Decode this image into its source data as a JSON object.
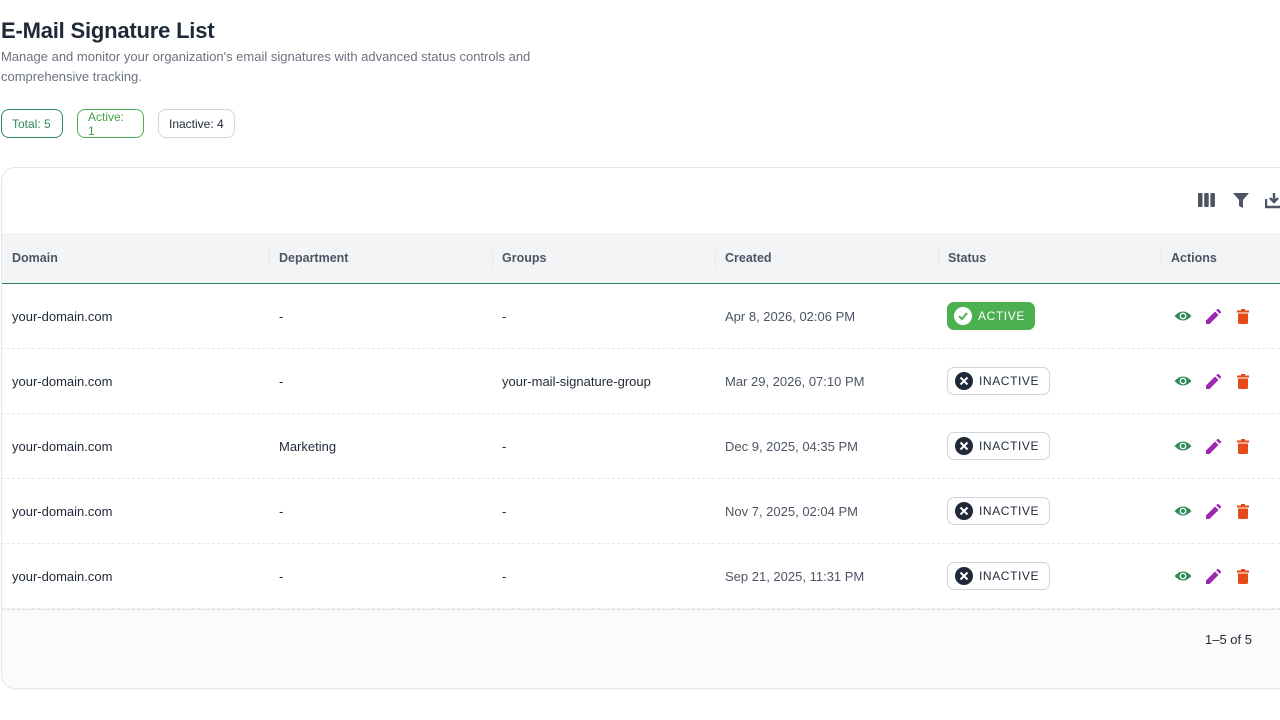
{
  "header": {
    "title": "E-Mail Signature List",
    "description": "Manage and monitor your organization's email signatures with advanced status controls and comprehensive tracking."
  },
  "stats": {
    "total": "Total: 5",
    "active": "Active: 1",
    "inactive": "Inactive: 4"
  },
  "toolbar": {
    "icons": [
      "columns-icon",
      "filter-icon",
      "export-icon"
    ]
  },
  "table": {
    "columns": {
      "domain": "Domain",
      "department": "Department",
      "groups": "Groups",
      "created": "Created",
      "status": "Status",
      "actions": "Actions"
    },
    "rows": [
      {
        "domain": "your-domain.com",
        "department": "-",
        "groups": "-",
        "created": "Apr 8, 2026, 02:06 PM",
        "status": "ACTIVE"
      },
      {
        "domain": "your-domain.com",
        "department": "-",
        "groups": "your-mail-signature-group",
        "created": "Mar 29, 2026, 07:10 PM",
        "status": "INACTIVE"
      },
      {
        "domain": "your-domain.com",
        "department": "Marketing",
        "groups": "-",
        "created": "Dec 9, 2025, 04:35 PM",
        "status": "INACTIVE"
      },
      {
        "domain": "your-domain.com",
        "department": "-",
        "groups": "-",
        "created": "Nov 7, 2025, 02:04 PM",
        "status": "INACTIVE"
      },
      {
        "domain": "your-domain.com",
        "department": "-",
        "groups": "-",
        "created": "Sep 21, 2025, 11:31 PM",
        "status": "INACTIVE"
      }
    ]
  },
  "footer": {
    "pagination": "1–5 of 5"
  },
  "colors": {
    "brand_green": "#2e8b57",
    "active_green": "#4caf50",
    "view_icon": "#2e8b57",
    "edit_icon": "#9c27b0",
    "delete_icon": "#e64a19"
  }
}
